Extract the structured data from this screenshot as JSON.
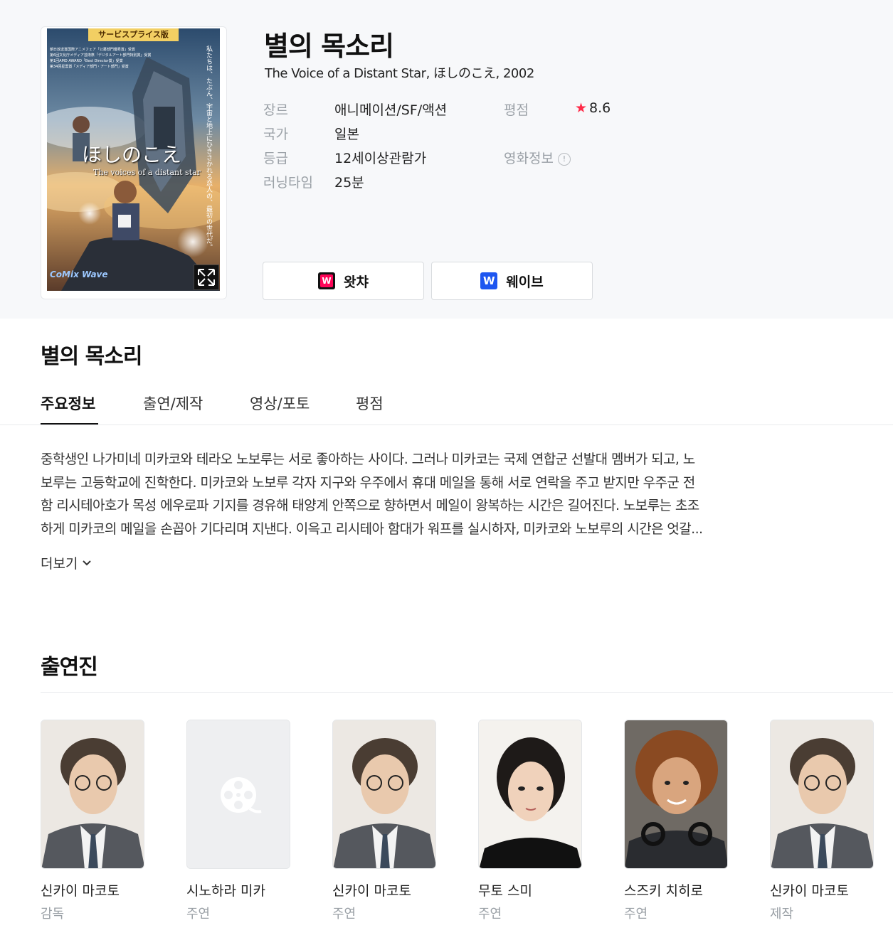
{
  "movie": {
    "title": "별의 목소리",
    "subtitle": "The Voice of a Distant Star, ほしのこえ, 2002"
  },
  "poster": {
    "badge": "サービスプライス版",
    "awards": [
      "朝日放送賞国際アニメフェア「公募部門優秀賞」受賞",
      "第6回文化庁メディア芸術祭「デジタルアート部門特別賞」受賞",
      "第1回AMD AWARD「Best Director賞」受賞",
      "第34回星雲賞「メディア部門・アート部門」受賞"
    ],
    "vertical_text": "私たちは、たぶん、宇宙と地上にひきさかれる恋人の、最初の世代だ。",
    "title": "ほしのこえ",
    "subtitle": "The voices of a distant star",
    "logo": "CoMix Wave",
    "expand_icon": "expand-icon"
  },
  "info": {
    "genre_label": "장르",
    "genre": "애니메이션/SF/액션",
    "country_label": "국가",
    "country": "일본",
    "grade_label": "등급",
    "grade": "12세이상관람가",
    "runtime_label": "러닝타임",
    "runtime": "25분",
    "rating_label": "평점",
    "rating": "8.6",
    "movie_info_label": "영화정보"
  },
  "ott": [
    {
      "label": "왓챠",
      "logo": "W",
      "color": "#ff0558"
    },
    {
      "label": "웨이브",
      "logo": "W",
      "color": "#1e56f0"
    }
  ],
  "section_title": "별의 목소리",
  "tabs": [
    "주요정보",
    "출연/제작",
    "영상/포토",
    "평점"
  ],
  "synopsis": [
    "중학생인 나가미네 미카코와 테라오 노보루는 서로 좋아하는 사이다. 그러나 미카코는 국제 연합군 선발대 멤버가 되고, 노",
    "보루는 고등학교에 진학한다. 미카코와 노보루 각자 지구와 우주에서 휴대 메일을 통해 서로 연락을 주고 받지만 우주군 전",
    "함 리시테아호가 목성 에우로파 기지를 경유해 태양계 안쪽으로 향하면서 메일이 왕복하는 시간은 길어진다. 노보루는 초조",
    "하게 미카코의 메일을 손꼽아 기다리며 지낸다. 이윽고 리시테아 함대가 워프를 실시하자, 미카코와 노보루의 시간은 엇갈..."
  ],
  "more_label": "더보기",
  "cast_title": "출연진",
  "cast": [
    {
      "name": "신카이 마코토",
      "role": "감독"
    },
    {
      "name": "시노하라 미카",
      "role": "주연"
    },
    {
      "name": "신카이 마코토",
      "role": "주연"
    },
    {
      "name": "무토 스미",
      "role": "주연"
    },
    {
      "name": "스즈키 치히로",
      "role": "주연"
    },
    {
      "name": "신카이 마코토",
      "role": "제작"
    }
  ]
}
